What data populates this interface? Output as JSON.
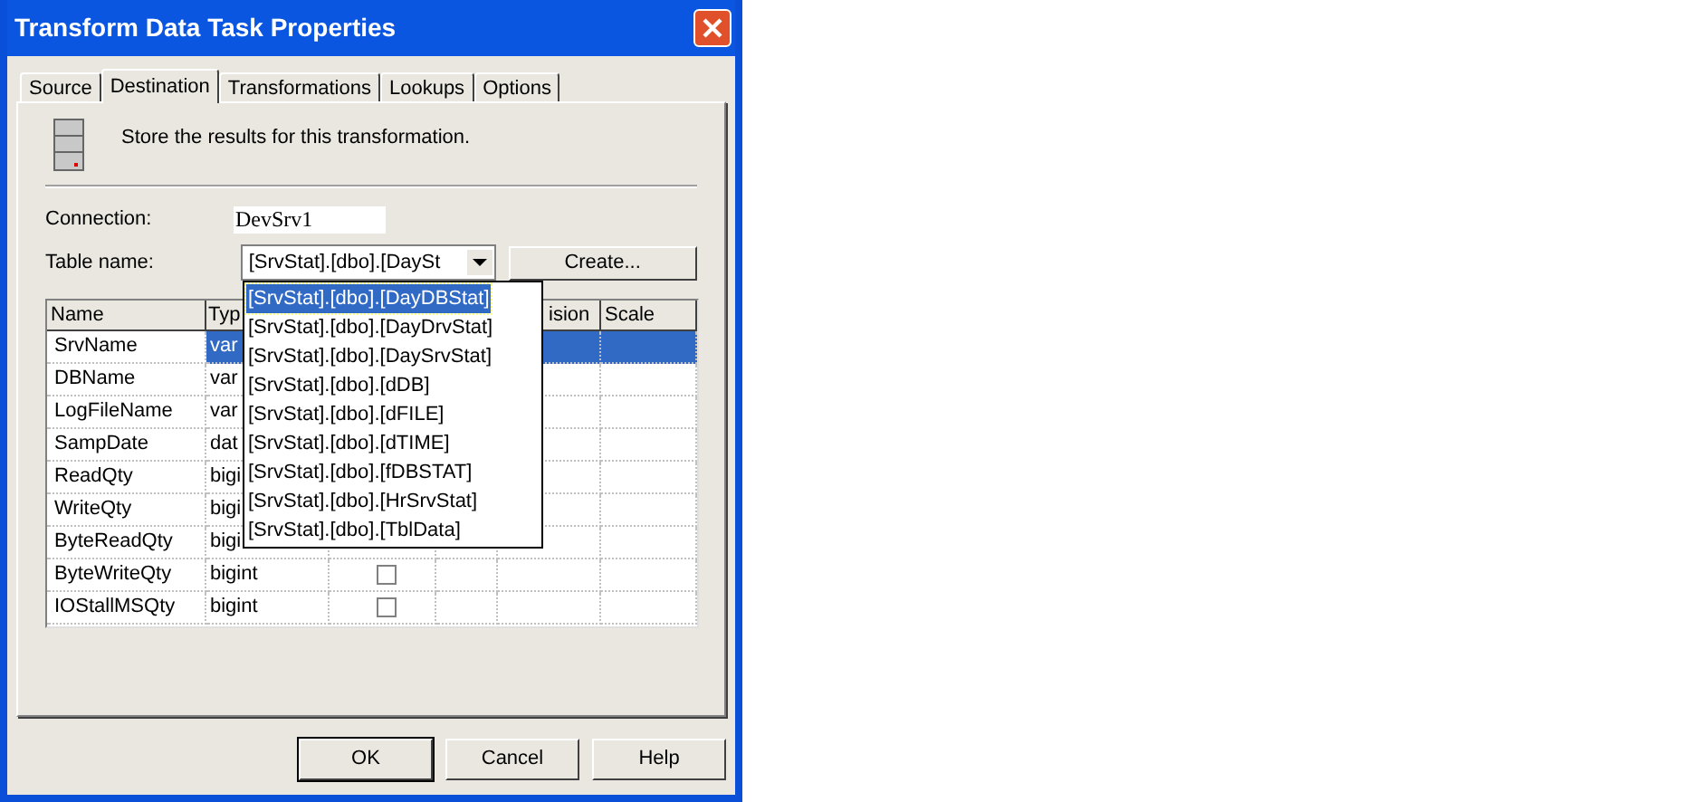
{
  "window": {
    "title": "Transform Data Task Properties"
  },
  "tabs": [
    {
      "label": "Source",
      "selected": false
    },
    {
      "label": "Destination",
      "selected": true
    },
    {
      "label": "Transformations",
      "selected": false
    },
    {
      "label": "Lookups",
      "selected": false
    },
    {
      "label": "Options",
      "selected": false
    }
  ],
  "description": "Store the results for this transformation.",
  "connection": {
    "label": "Connection:",
    "value": "DevSrv1"
  },
  "table_name": {
    "label": "Table name:",
    "value": "[SrvStat].[dbo].[DaySt",
    "create_button": "Create...",
    "dropdown": [
      {
        "label": "[SrvStat].[dbo].[DayDBStat]",
        "selected": true
      },
      {
        "label": "[SrvStat].[dbo].[DayDrvStat]",
        "selected": false
      },
      {
        "label": "[SrvStat].[dbo].[DaySrvStat]",
        "selected": false
      },
      {
        "label": "[SrvStat].[dbo].[dDB]",
        "selected": false
      },
      {
        "label": "[SrvStat].[dbo].[dFILE]",
        "selected": false
      },
      {
        "label": "[SrvStat].[dbo].[dTIME]",
        "selected": false
      },
      {
        "label": "[SrvStat].[dbo].[fDBSTAT]",
        "selected": false
      },
      {
        "label": "[SrvStat].[dbo].[HrSrvStat]",
        "selected": false
      },
      {
        "label": "[SrvStat].[dbo].[TblData]",
        "selected": false
      }
    ]
  },
  "table": {
    "columns": [
      "Name",
      "Typ",
      "",
      "",
      "ision",
      "Scale"
    ],
    "rows": [
      {
        "name": "SrvName",
        "type": "var",
        "selected": true
      },
      {
        "name": "DBName",
        "type": "var",
        "selected": false
      },
      {
        "name": "LogFileName",
        "type": "var",
        "selected": false
      },
      {
        "name": "SampDate",
        "type": "dat",
        "selected": false
      },
      {
        "name": "ReadQty",
        "type": "bigi",
        "selected": false
      },
      {
        "name": "WriteQty",
        "type": "bigi",
        "selected": false
      },
      {
        "name": "ByteReadQty",
        "type": "bigi",
        "selected": false
      },
      {
        "name": "ByteWriteQty",
        "type": "bigint",
        "selected": false,
        "nullable": false
      },
      {
        "name": "IOStallMSQty",
        "type": "bigint",
        "selected": false,
        "nullable": false
      }
    ]
  },
  "buttons": [
    "OK",
    "Cancel",
    "Help"
  ]
}
